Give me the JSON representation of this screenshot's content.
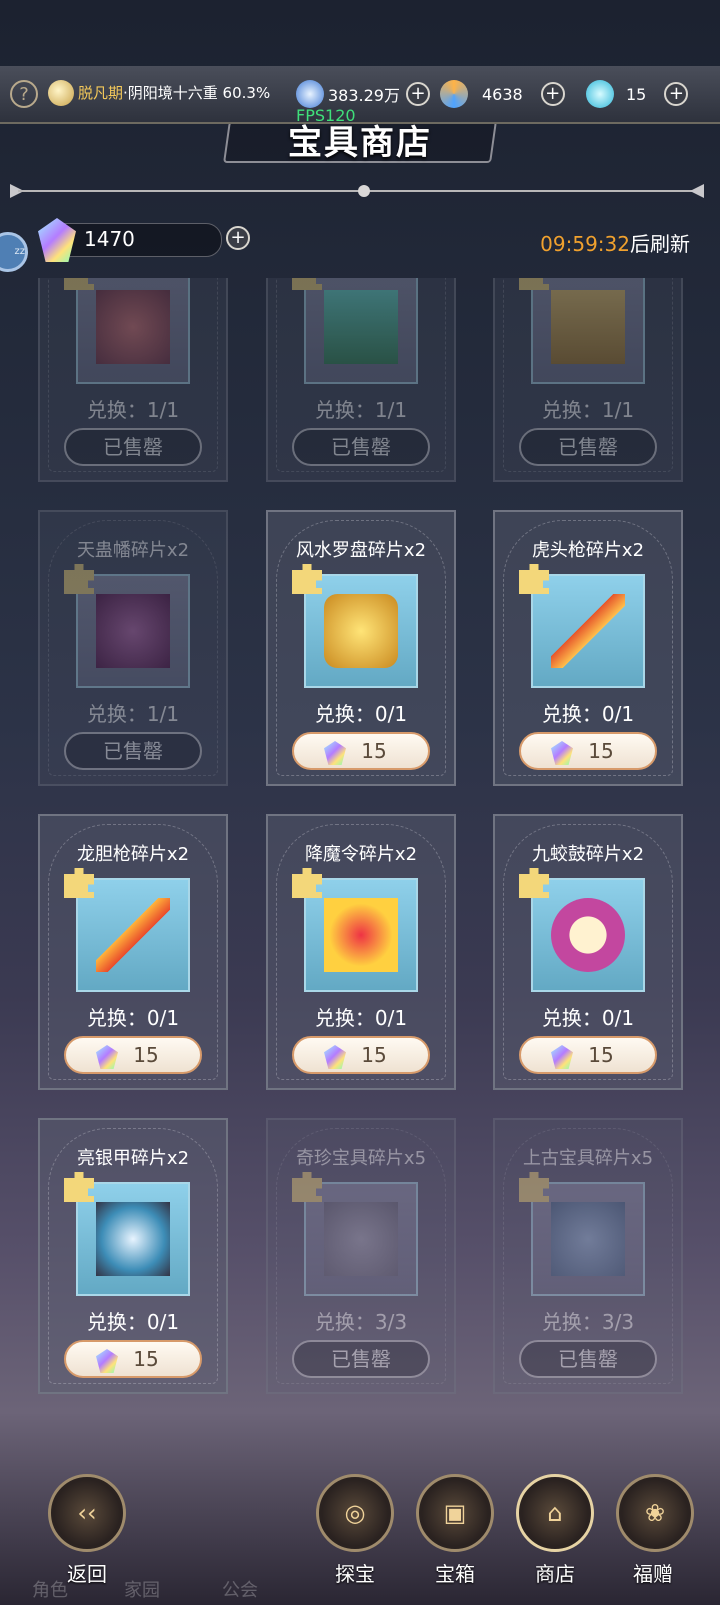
{
  "topbar": {
    "realm_gold": "脱凡期",
    "realm_rest": "·阴阳境十六重 60.3%",
    "currency1": "383.29万",
    "currency2": "4638",
    "currency3": "15"
  },
  "fps": "FPS120",
  "title": "宝具商店",
  "gems": {
    "value": "1470"
  },
  "timer": {
    "time": "09:59:32",
    "suffix": "后刷新"
  },
  "side_label": "zz",
  "cards": [
    {
      "name": "",
      "exchange": "兑换：1/1",
      "button": "已售罄",
      "sold": true
    },
    {
      "name": "",
      "exchange": "兑换：1/1",
      "button": "已售罄",
      "sold": true
    },
    {
      "name": "",
      "exchange": "兑换：1/1",
      "button": "已售罄",
      "sold": true
    },
    {
      "name": "天蛊幡碎片x2",
      "exchange": "兑换：1/1",
      "button": "已售罄",
      "sold": true
    },
    {
      "name": "风水罗盘碎片x2",
      "exchange": "兑换：0/1",
      "button": "15",
      "sold": false
    },
    {
      "name": "虎头枪碎片x2",
      "exchange": "兑换：0/1",
      "button": "15",
      "sold": false
    },
    {
      "name": "龙胆枪碎片x2",
      "exchange": "兑换：0/1",
      "button": "15",
      "sold": false
    },
    {
      "name": "降魔令碎片x2",
      "exchange": "兑换：0/1",
      "button": "15",
      "sold": false
    },
    {
      "name": "九蛟鼓碎片x2",
      "exchange": "兑换：0/1",
      "button": "15",
      "sold": false
    },
    {
      "name": "亮银甲碎片x2",
      "exchange": "兑换：0/1",
      "button": "15",
      "sold": false
    },
    {
      "name": "奇珍宝具碎片x5",
      "exchange": "兑换：3/3",
      "button": "已售罄",
      "sold": true
    },
    {
      "name": "上古宝具碎片x5",
      "exchange": "兑换：3/3",
      "button": "已售罄",
      "sold": true
    }
  ],
  "nav": {
    "back": "返回",
    "explore": "探宝",
    "chest": "宝箱",
    "shop": "商店",
    "gift": "福赠"
  },
  "ghost_tabs": [
    "角色",
    "家园",
    "公会"
  ]
}
